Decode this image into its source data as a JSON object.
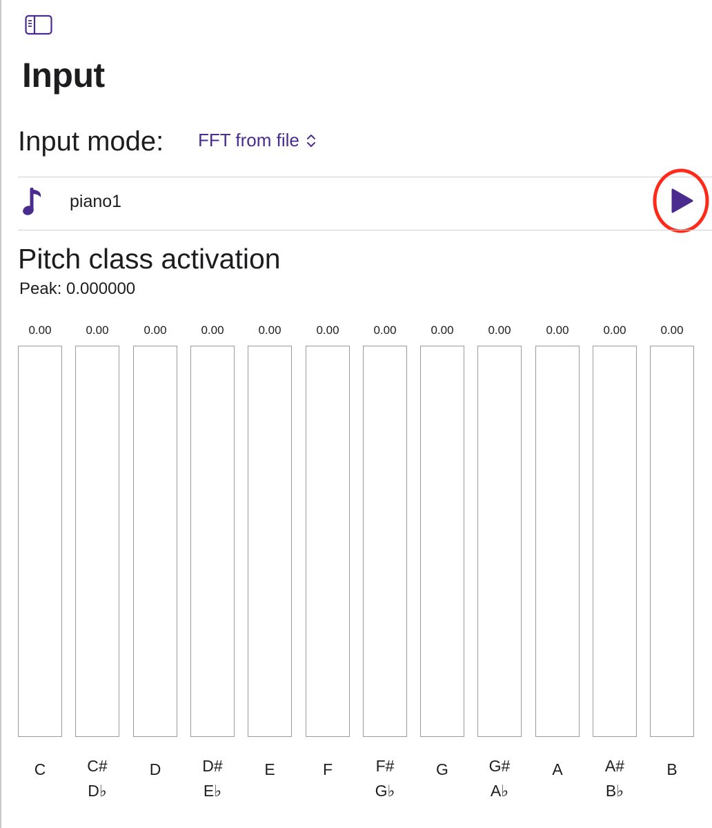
{
  "page": {
    "title": "Input",
    "sidebar_toggle_icon": "sidebar-toggle-icon"
  },
  "input_mode": {
    "label": "Input mode:",
    "selected": "FFT from file",
    "icon": "chevron-up-down-icon"
  },
  "file": {
    "name": "piano1",
    "icon": "music-note-icon",
    "play_icon": "play-icon",
    "accent_color": "#4a2c8f",
    "highlight_color": "#ff2a1a"
  },
  "pitch": {
    "title": "Pitch class activation",
    "peak": "Peak: 0.000000"
  },
  "chart_data": {
    "type": "bar",
    "categories": [
      "C",
      "C#/Db",
      "D",
      "D#/Eb",
      "E",
      "F",
      "F#/Gb",
      "G",
      "G#/Ab",
      "A",
      "A#/Bb",
      "B"
    ],
    "values": [
      0,
      0,
      0,
      0,
      0,
      0,
      0,
      0,
      0,
      0,
      0,
      0
    ],
    "value_labels": [
      "0.00",
      "0.00",
      "0.00",
      "0.00",
      "0.00",
      "0.00",
      "0.00",
      "0.00",
      "0.00",
      "0.00",
      "0.00",
      "0.00"
    ],
    "note_labels": [
      [
        "C"
      ],
      [
        "C#",
        "D♭"
      ],
      [
        "D"
      ],
      [
        "D#",
        "E♭"
      ],
      [
        "E"
      ],
      [
        "F"
      ],
      [
        "F#",
        "G♭"
      ],
      [
        "G"
      ],
      [
        "G#",
        "A♭"
      ],
      [
        "A"
      ],
      [
        "A#",
        "B♭"
      ],
      [
        "B"
      ]
    ],
    "ylim": [
      0,
      1
    ],
    "bar_color": "#4a2c8f"
  }
}
